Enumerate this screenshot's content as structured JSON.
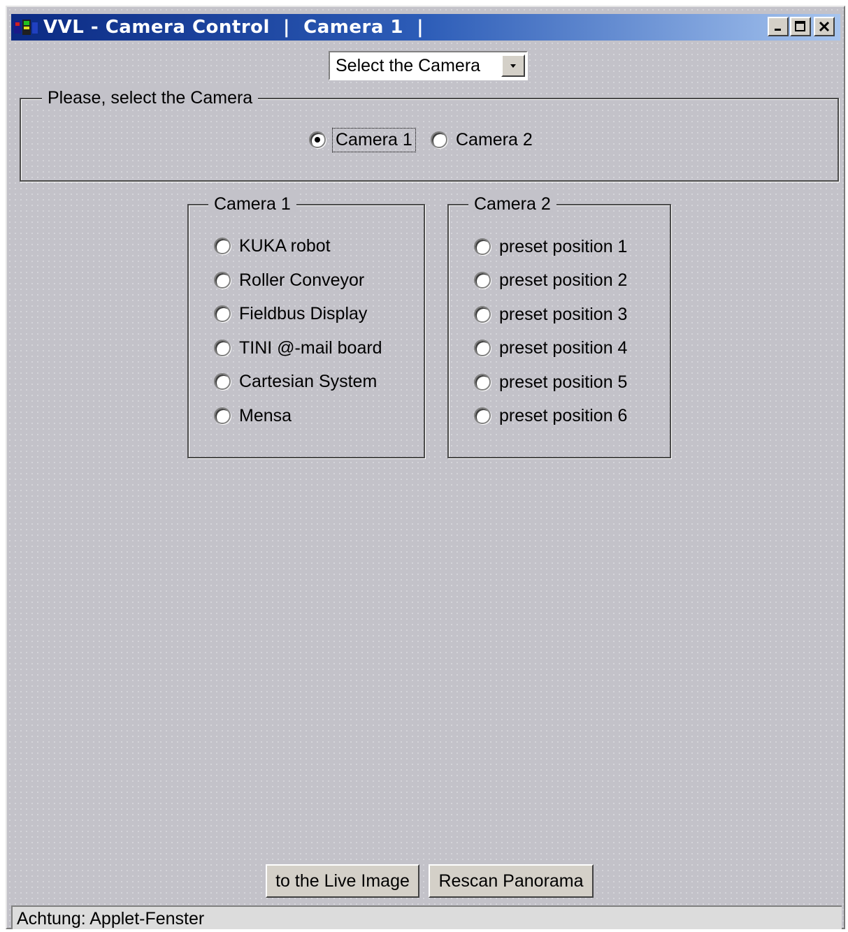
{
  "window": {
    "title": "VVL - Camera Control  |  Camera 1  |",
    "controls": {
      "minimize": "minimize-icon",
      "maximize": "maximize-icon",
      "close": "close-icon"
    }
  },
  "camera_dropdown": {
    "value": "Select the Camera"
  },
  "select_group": {
    "legend": "Please, select the Camera",
    "options": [
      {
        "label": "Camera 1",
        "checked": true
      },
      {
        "label": "Camera 2",
        "checked": false
      }
    ]
  },
  "camera1_group": {
    "legend": "Camera 1",
    "options": [
      {
        "label": "KUKA robot"
      },
      {
        "label": "Roller Conveyor"
      },
      {
        "label": "Fieldbus Display"
      },
      {
        "label": "TINI @-mail board"
      },
      {
        "label": "Cartesian System"
      },
      {
        "label": "Mensa"
      }
    ]
  },
  "camera2_group": {
    "legend": "Camera 2",
    "options": [
      {
        "label": "preset position 1"
      },
      {
        "label": "preset position 2"
      },
      {
        "label": "preset position 3"
      },
      {
        "label": "preset position 4"
      },
      {
        "label": "preset position 5"
      },
      {
        "label": "preset position 6"
      }
    ]
  },
  "buttons": {
    "live_image": "to the Live Image",
    "rescan": "Rescan Panorama"
  },
  "status_bar": {
    "text": "Achtung: Applet-Fenster"
  }
}
